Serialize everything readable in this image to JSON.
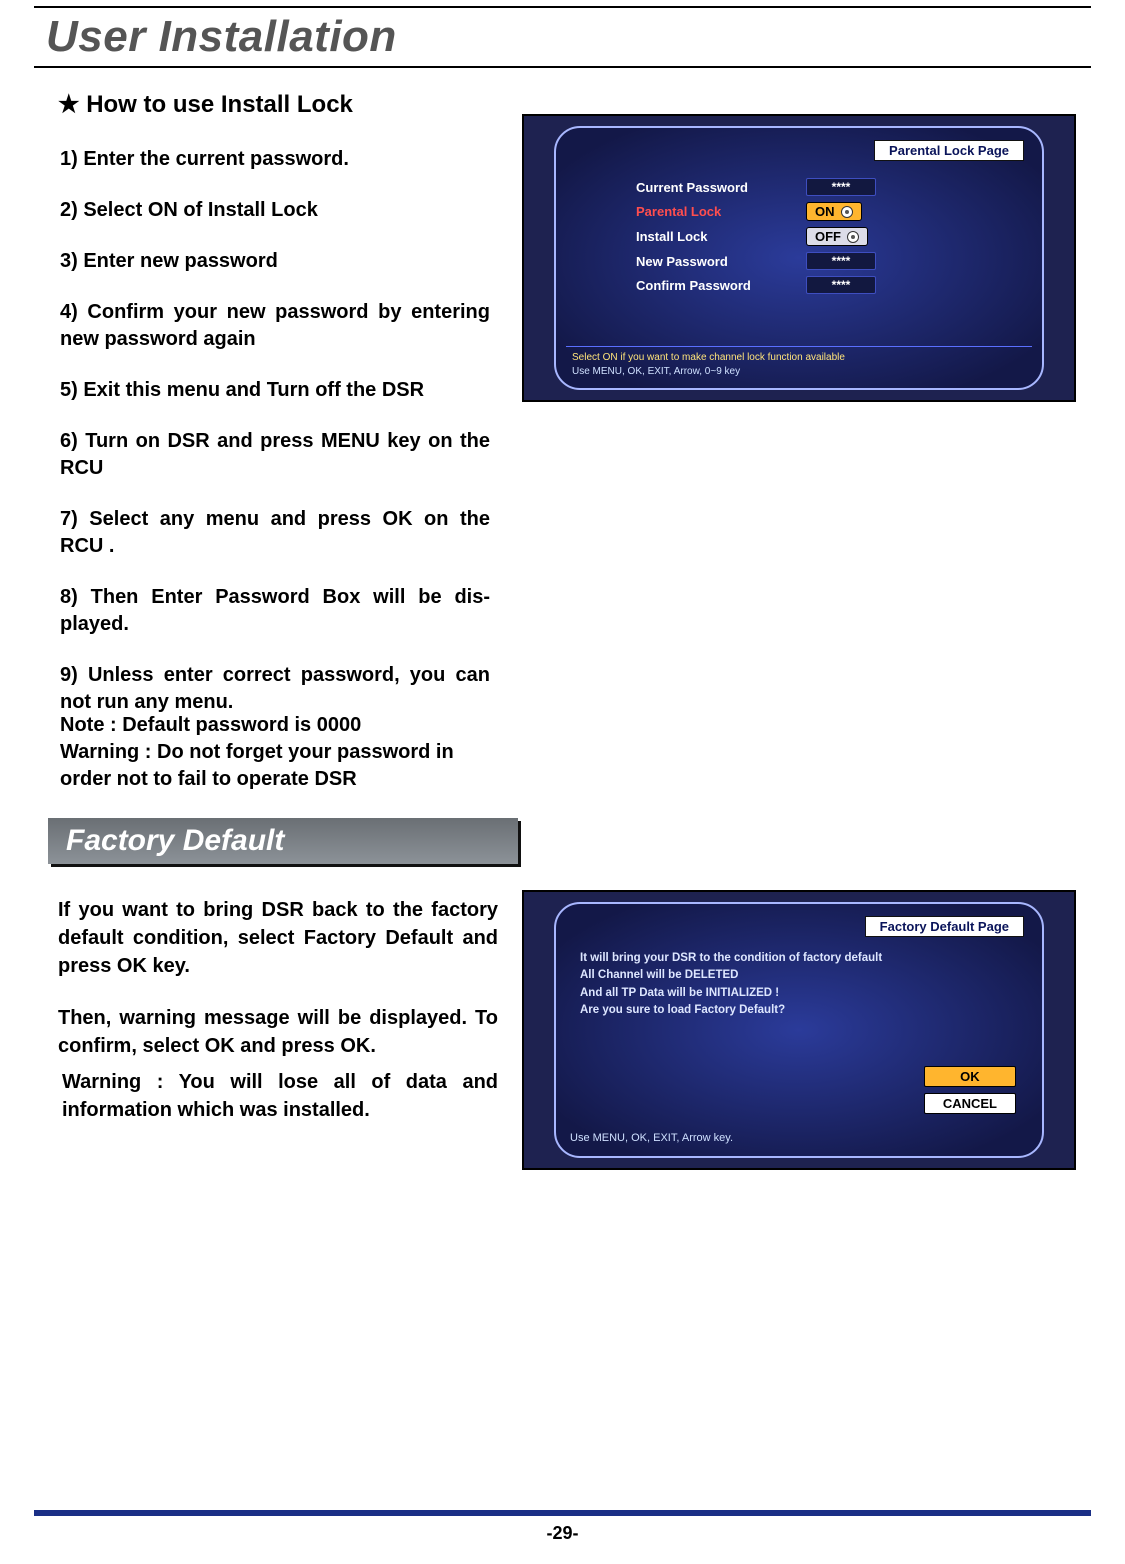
{
  "page": {
    "title": "User Installation",
    "subtitle_star": "★",
    "subtitle": "How to use Install Lock",
    "page_num": "-29-"
  },
  "steps": {
    "s1": "1) Enter the current password.",
    "s2": "2) Select ON of Install Lock",
    "s3": "3) Enter new password",
    "s4": "4) Confirm your new password by entering new password again",
    "s5": "5) Exit this menu and Turn off the DSR",
    "s6": "6) Turn on DSR and press MENU key on the RCU",
    "s7": "7) Select any menu and press OK on the RCU .",
    "s8": "8) Then Enter Password Box will be dis-played.",
    "s9": "9) Unless enter correct password, you can not run any menu."
  },
  "notes": {
    "note": "Note : Default password is 0000",
    "warn1": "Warning :  Do not forget your password in order not to fail to operate DSR"
  },
  "section2": {
    "heading": "Factory Default",
    "p1": "If you want to bring DSR back to the factory default condition, select Factory Default and press OK key.",
    "p2": "Then, warning message will be displayed. To confirm, select OK and press OK.",
    "warn": "Warning :  You will lose all of data and information which was installed."
  },
  "tv1": {
    "title": "Parental Lock Page",
    "rows": {
      "current_pw_label": "Current Password",
      "current_pw_val": "****",
      "parental_label": "Parental Lock",
      "parental_val": "ON",
      "install_label": "Install Lock",
      "install_val": "OFF",
      "new_pw_label": "New Password",
      "new_pw_val": "****",
      "confirm_label": "Confirm Password",
      "confirm_val": "****"
    },
    "hint1": "Select ON if you want to make channel lock function available",
    "hint2": "Use MENU, OK, EXIT, Arrow, 0~9 key"
  },
  "tv2": {
    "title": "Factory Default Page",
    "msg1": "It will bring your DSR to the condition of factory default",
    "msg2": "All Channel will be DELETED",
    "msg3": "And all TP Data will be INITIALIZED !",
    "msg4": "Are you sure to load Factory Default?",
    "ok": "OK",
    "cancel": "CANCEL",
    "hint": "Use MENU, OK, EXIT, Arrow key."
  }
}
